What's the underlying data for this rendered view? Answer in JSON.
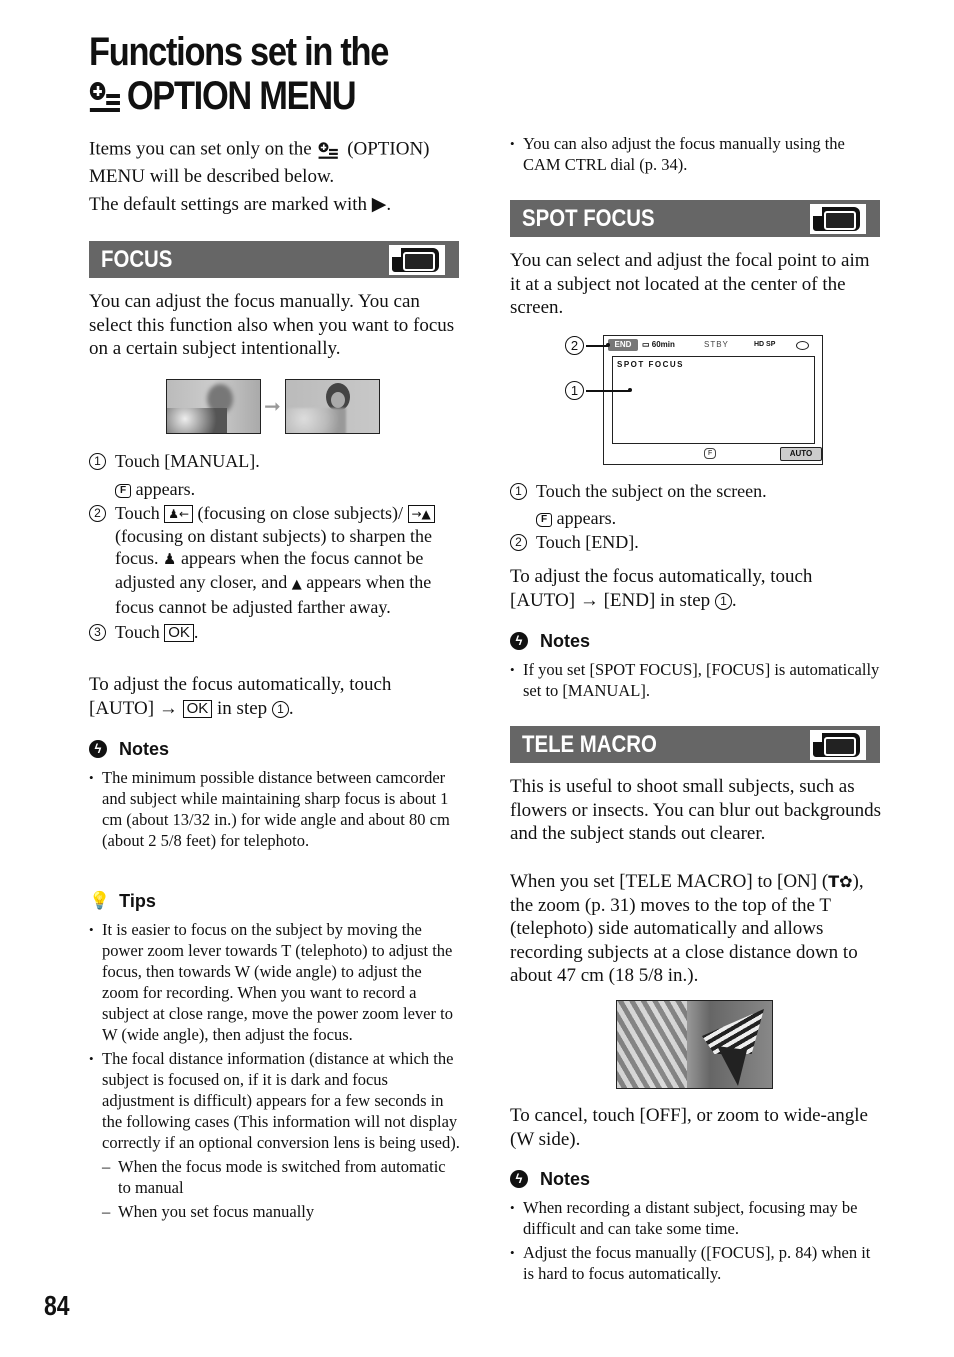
{
  "page": {
    "title_line1": "Functions set in the",
    "title_line2": "OPTION MENU",
    "page_number": "84"
  },
  "intro": {
    "p1_a": "Items you can set only on the",
    "p1_b": "(OPTION) MENU will be described below.",
    "p2": "The default settings are marked with ▶."
  },
  "focus": {
    "heading": "FOCUS",
    "body": "You can adjust the focus manually. You can select this function also when you want to focus on a certain subject intentionally.",
    "arrow": "➞",
    "steps": [
      {
        "num": "1",
        "text": "Touch [MANUAL].",
        "sub_mark": "F",
        "sub_text": "appears."
      },
      {
        "num": "2",
        "text_a": "Touch",
        "btn_near": "♟←",
        "text_b": "(focusing on close subjects)/",
        "btn_far": "→▲",
        "text_c": "(focusing on distant subjects) to sharpen the focus.",
        "near_glyph": "♟",
        "text_d": "appears when the focus cannot be adjusted any closer, and",
        "far_glyph": "▲",
        "text_e": "appears when the focus cannot be adjusted farther away."
      },
      {
        "num": "3",
        "text": "Touch",
        "btn": "OK"
      }
    ],
    "auto_a": "To adjust the focus automatically, touch [AUTO] →",
    "auto_btn": "OK",
    "auto_b": "in step",
    "auto_num": "1",
    "notes_label": "Notes",
    "notes": [
      "The minimum possible distance between camcorder and subject while maintaining sharp focus is about 1 cm (about 13/32 in.) for wide angle and about 80 cm (about 2 5/8 feet) for telephoto."
    ],
    "tips_label": "Tips",
    "tips": [
      "It is easier to focus on the subject by moving the power zoom lever towards T (telephoto) to adjust the focus, then towards W (wide angle) to adjust the zoom for recording. When you want to record a subject at close range, move the power zoom lever to W (wide angle), then adjust the focus.",
      "The focal distance information (distance at which the subject is focused on, if it is dark and focus adjustment is difficult) appears for a few seconds in the following cases (This information will not display correctly if an optional conversion lens is being used)."
    ],
    "tips_sub": [
      "When the focus mode is switched from automatic to manual",
      "When you set focus manually"
    ],
    "tips_extra": "You can also adjust the focus manually using the CAM CTRL dial (p. 34)."
  },
  "spot_focus": {
    "heading": "SPOT FOCUS",
    "body": "You can select and adjust the focal point to aim it at a subject not located at the center of the screen.",
    "lcd": {
      "end": "END",
      "battery": "60min",
      "status": "STBY",
      "quality": "HD SP",
      "screen_title": "SPOT FOCUS",
      "manual_mark": "F",
      "auto": "AUTO",
      "callout_1": "1",
      "callout_2": "2"
    },
    "steps": [
      {
        "num": "1",
        "text": "Touch the subject on the screen.",
        "sub_mark": "F",
        "sub_text": "appears."
      },
      {
        "num": "2",
        "text": "Touch [END]."
      }
    ],
    "auto_a": "To adjust the focus automatically, touch [AUTO] → [END] in step",
    "auto_num": "1",
    "notes_label": "Notes",
    "notes": [
      "If you set [SPOT FOCUS], [FOCUS] is automatically set to [MANUAL]."
    ]
  },
  "tele_macro": {
    "heading": "TELE MACRO",
    "body1": "This is useful to shoot small subjects, such as flowers or insects. You can blur out backgrounds and the subject stands out clearer.",
    "body2_a": "When you set [TELE MACRO] to [ON] (",
    "body2_icon": "T✿",
    "body2_b": "), the zoom (p. 31) moves to the top of the T (telephoto) side automatically and allows recording subjects at a close distance down to about 47 cm (18 5/8 in.).",
    "cancel": "To cancel, touch [OFF], or zoom to wide-angle (W side).",
    "notes_label": "Notes",
    "notes": [
      "When recording a distant subject, focusing may be difficult and can take some time.",
      "Adjust the focus manually ([FOCUS], p. 84) when it is hard to focus automatically."
    ]
  }
}
